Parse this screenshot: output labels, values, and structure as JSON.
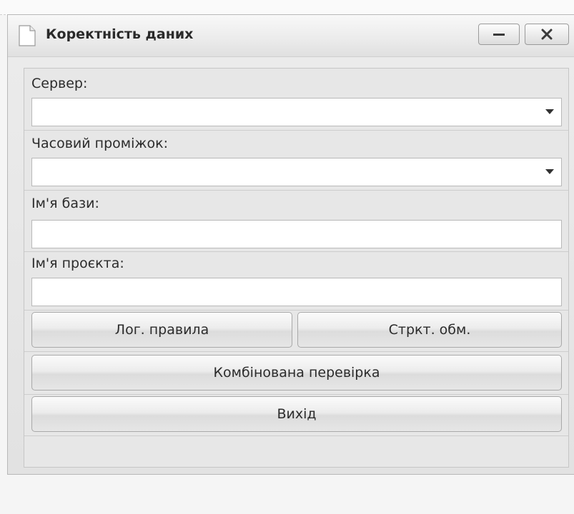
{
  "window": {
    "title": "Коректність даних",
    "icon": "document-icon"
  },
  "form": {
    "server_label": "Сервер:",
    "server_value": "",
    "time_range_label": "Часовий проміжок:",
    "time_range_value": "",
    "db_name_label": "Ім'я бази:",
    "db_name_value": "",
    "project_name_label": "Ім'я проєкта:",
    "project_name_value": ""
  },
  "buttons": {
    "log_rules": "Лог. правила",
    "struct_exchange": "Стркт. обм.",
    "combined_check": "Комбінована перевірка",
    "exit": "Вихід"
  }
}
